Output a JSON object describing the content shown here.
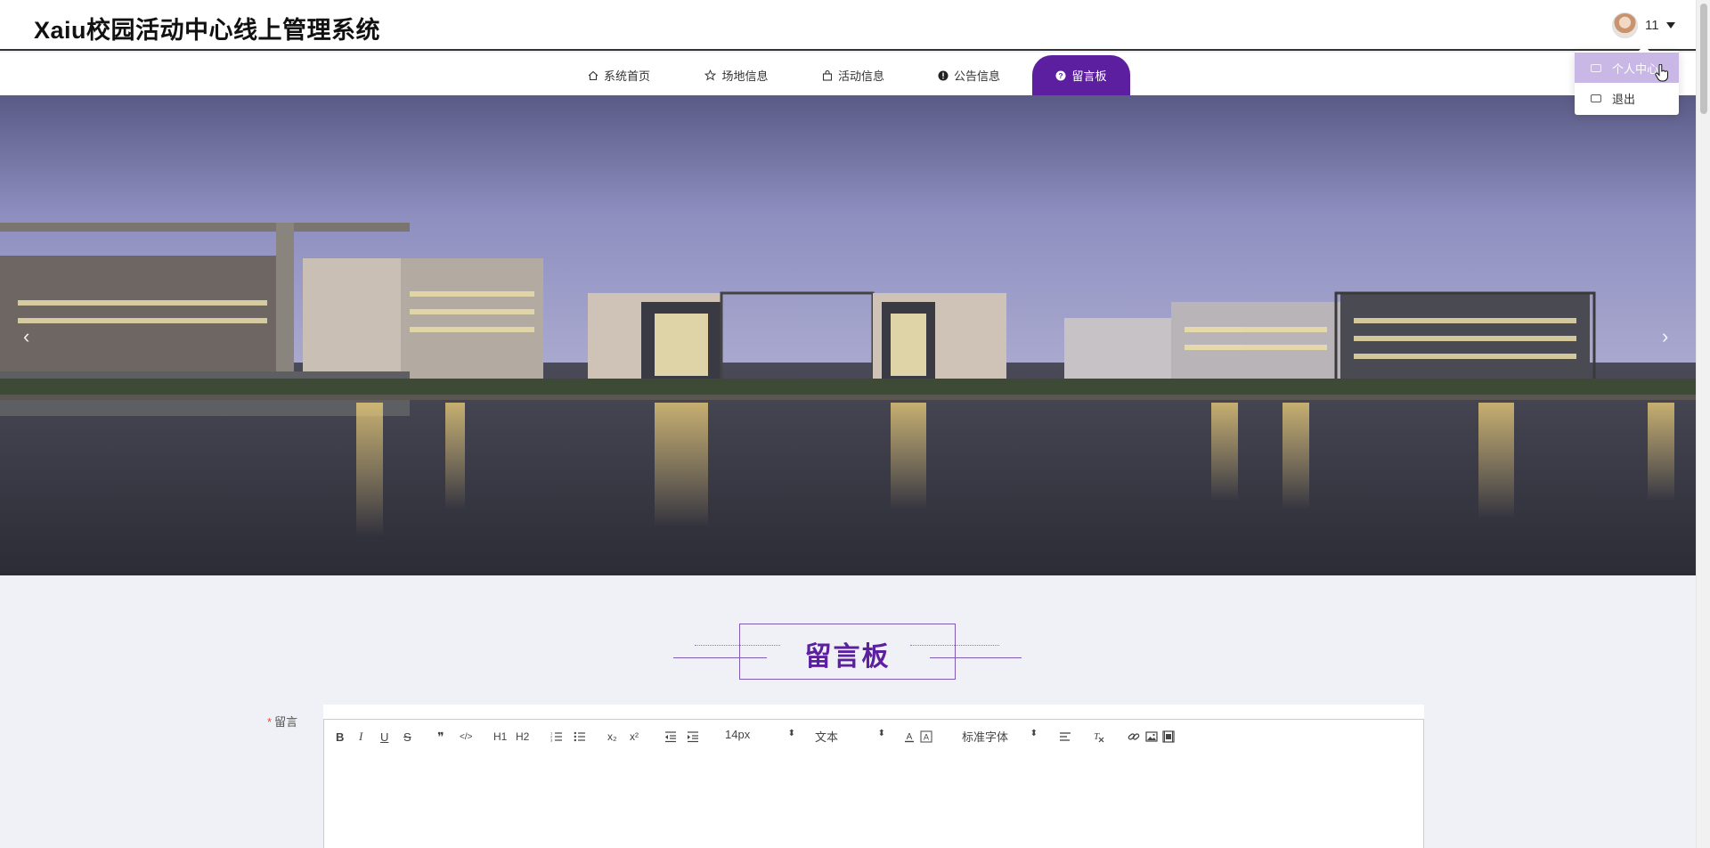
{
  "header": {
    "site_title": "Xaiu校园活动中心线上管理系统",
    "user_name": "11"
  },
  "user_menu": {
    "items": [
      {
        "label": "个人中心",
        "icon": "id-card-icon",
        "active": true
      },
      {
        "label": "退出",
        "icon": "logout-icon",
        "active": false
      }
    ]
  },
  "nav": {
    "items": [
      {
        "label": "系统首页",
        "icon": "home-icon"
      },
      {
        "label": "场地信息",
        "icon": "star-icon"
      },
      {
        "label": "活动信息",
        "icon": "bag-icon"
      },
      {
        "label": "公告信息",
        "icon": "info-icon"
      },
      {
        "label": "留言板",
        "icon": "question-icon",
        "active": true
      }
    ]
  },
  "banner": {
    "prev": "‹",
    "next": "›"
  },
  "section": {
    "title": "留言板"
  },
  "form": {
    "message_label": "留言",
    "required_mark": "*",
    "toolbar": {
      "bold": "B",
      "italic": "I",
      "underline": "U",
      "strike": "S",
      "quote": "❞",
      "code": "</>",
      "h1": "H1",
      "h2": "H2",
      "sub": "x₂",
      "sup": "x²",
      "size": "14px",
      "header": "文本",
      "font": "标准字体"
    }
  },
  "colors": {
    "accent": "#5b1fa0",
    "menu_active": "#c9b8e6",
    "page_bg": "#f0f1f6"
  }
}
